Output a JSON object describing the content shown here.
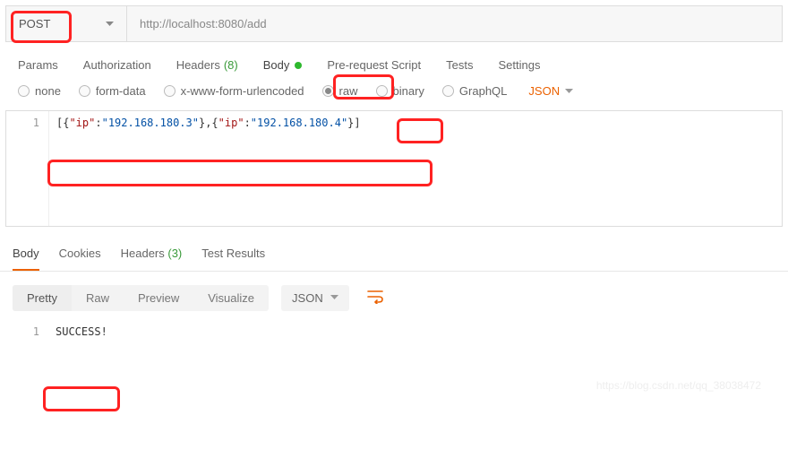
{
  "request": {
    "method": "POST",
    "url": "http://localhost:8080/add"
  },
  "reqTabs": {
    "params": "Params",
    "auth": "Authorization",
    "headers": "Headers",
    "headersCount": "(8)",
    "body": "Body",
    "prereq": "Pre-request Script",
    "tests": "Tests",
    "settings": "Settings"
  },
  "bodyTypes": {
    "none": "none",
    "formdata": "form-data",
    "xwww": "x-www-form-urlencoded",
    "raw": "raw",
    "binary": "binary",
    "graphql": "GraphQL",
    "langLabel": "JSON"
  },
  "requestBody": {
    "lineNum": "1",
    "tokens": {
      "o1": "[{",
      "k1": "\"ip\"",
      "c1": ":",
      "v1": "\"192.168.180.3\"",
      "s1": "},{",
      "k2": "\"ip\"",
      "c2": ":",
      "v2": "\"192.168.180.4\"",
      "o2": "}]"
    }
  },
  "respTabs": {
    "body": "Body",
    "cookies": "Cookies",
    "headers": "Headers",
    "headersCount": "(3)",
    "tests": "Test Results"
  },
  "viewModes": {
    "pretty": "Pretty",
    "raw": "Raw",
    "preview": "Preview",
    "visualize": "Visualize",
    "type": "JSON"
  },
  "responseBody": {
    "lineNum": "1",
    "text": "SUCCESS!"
  },
  "watermark": "https://blog.csdn.net/qq_38038472"
}
